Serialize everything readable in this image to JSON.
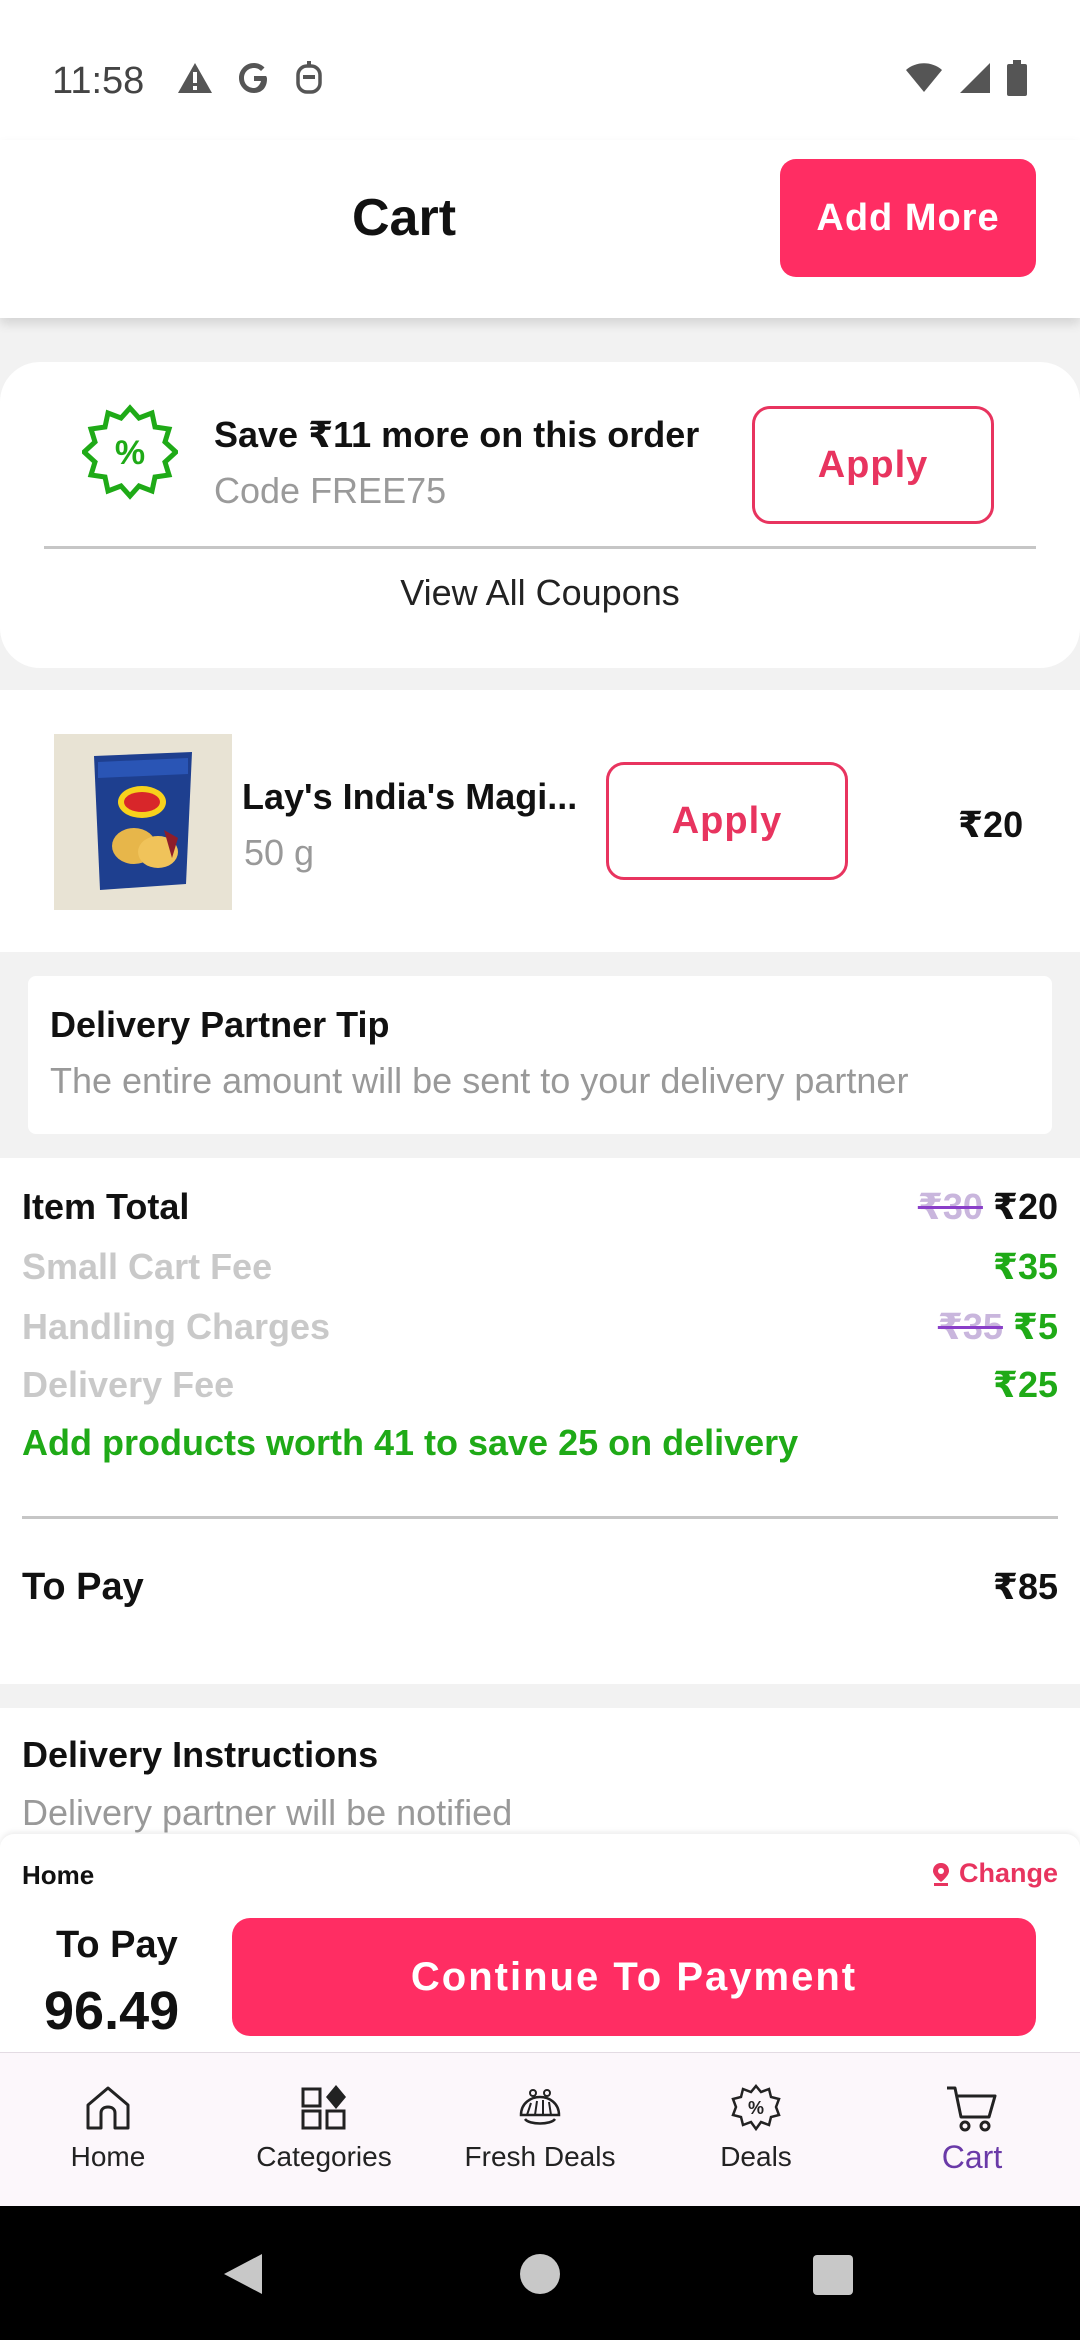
{
  "status_bar": {
    "time": "11:58"
  },
  "header": {
    "title": "Cart",
    "add_more_label": "Add More"
  },
  "coupon": {
    "title": "Save ₹11 more on this order",
    "code": "Code FREE75",
    "apply_label": "Apply",
    "view_all_label": "View All Coupons"
  },
  "product": {
    "name": "Lay's India's Magi...",
    "weight": "50 g",
    "apply_label": "Apply",
    "price": "₹20"
  },
  "tip": {
    "title": "Delivery Partner Tip",
    "subtitle": "The entire amount will be sent to your delivery partner"
  },
  "bill": {
    "item_total": {
      "label": "Item Total",
      "old": "₹30",
      "value": "₹20"
    },
    "small_cart_fee": {
      "label": "Small Cart Fee",
      "value": "₹35"
    },
    "handling": {
      "label": "Handling Charges",
      "old": "₹35",
      "value": "₹5"
    },
    "delivery_fee": {
      "label": "Delivery Fee",
      "value": "₹25"
    },
    "promo": "Add products worth 41 to save 25 on delivery",
    "to_pay_label": "To Pay",
    "to_pay_value": "₹85"
  },
  "instructions": {
    "title": "Delivery Instructions",
    "subtitle": "Delivery partner will be notified"
  },
  "payment": {
    "address_label": "Home",
    "change_label": "Change",
    "to_pay_label": "To Pay",
    "amount": "96.49",
    "continue_label": "Continue To Payment"
  },
  "nav": {
    "items": [
      {
        "label": "Home",
        "icon": "home-icon"
      },
      {
        "label": "Categories",
        "icon": "categories-icon"
      },
      {
        "label": "Fresh Deals",
        "icon": "fresh-deals-icon"
      },
      {
        "label": "Deals",
        "icon": "deals-icon"
      },
      {
        "label": "Cart",
        "icon": "cart-icon"
      }
    ],
    "active": "Cart"
  },
  "colors": {
    "accent": "#ff2d63",
    "green": "#1faa17",
    "active_nav": "#6a3aa8"
  }
}
